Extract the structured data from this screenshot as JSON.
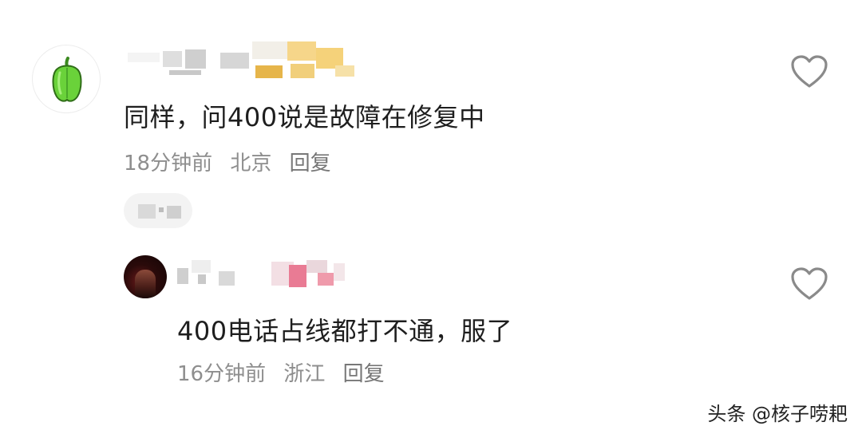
{
  "comments": [
    {
      "text": "同样，问400说是故障在修复中",
      "time": "18分钟前",
      "location": "北京",
      "reply_label": "回复",
      "avatar_icon": "green-pepper-icon"
    }
  ],
  "replies": [
    {
      "text": "400电话占线都打不通，服了",
      "time": "16分钟前",
      "location": "浙江",
      "reply_label": "回复"
    }
  ],
  "colors": {
    "text": "#1e1e1e",
    "meta": "#8e8e8e",
    "pepper_green": "#6ad23a",
    "heart_outline": "#8a8a8a"
  },
  "watermark": "头条 @核子唠耙"
}
